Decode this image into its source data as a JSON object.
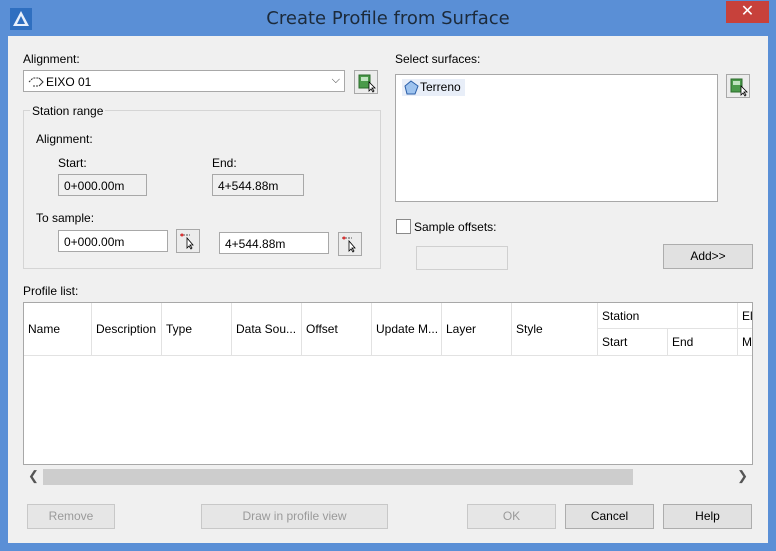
{
  "window": {
    "title": "Create Profile from Surface",
    "close_glyph": "✕"
  },
  "alignment": {
    "label": "Alignment:",
    "selected": "EIXO 01"
  },
  "station_range": {
    "group_label": "Station range",
    "alignment_label": "Alignment:",
    "start_label": "Start:",
    "end_label": "End:",
    "start_value": "0+000.00m",
    "end_value": "4+544.88m",
    "to_sample_label": "To sample:",
    "sample_start": "0+000.00m",
    "sample_end": "4+544.88m"
  },
  "surfaces": {
    "label": "Select surfaces:",
    "items": [
      "Terreno"
    ]
  },
  "sample_offsets": {
    "label": "Sample offsets:",
    "checked": false,
    "value": ""
  },
  "add_button": "Add>>",
  "profile_list": {
    "label": "Profile list:",
    "columns": [
      "Name",
      "Description",
      "Type",
      "Data Sou...",
      "Offset",
      "Update M...",
      "Layer",
      "Style"
    ],
    "station_group": "Station",
    "station_sub": [
      "Start",
      "End"
    ],
    "elevation_group": "El",
    "elevation_sub": [
      "M"
    ]
  },
  "buttons": {
    "remove": "Remove",
    "draw": "Draw in profile view",
    "ok": "OK",
    "cancel": "Cancel",
    "help": "Help"
  },
  "colors": {
    "titlebar": "#5a8fd6",
    "close": "#c7413b",
    "dialog_bg": "#f0f0f0"
  }
}
